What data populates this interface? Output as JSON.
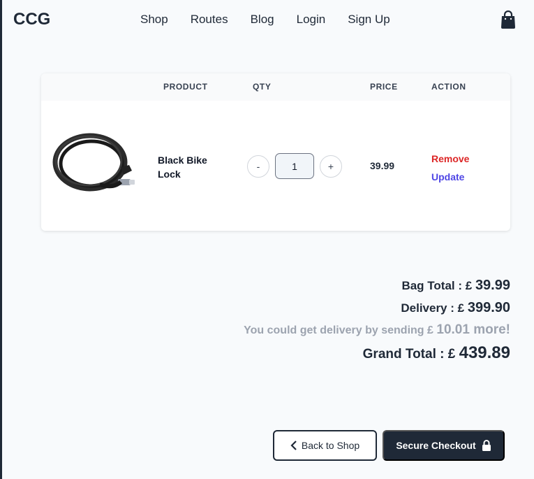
{
  "header": {
    "logo": "CCG",
    "nav": [
      "Shop",
      "Routes",
      "Blog",
      "Login",
      "Sign Up"
    ]
  },
  "cart": {
    "columns": {
      "product": "PRODUCT",
      "qty": "QTY",
      "price": "PRICE",
      "action": "ACTION"
    },
    "items": [
      {
        "name": "Black Bike Lock",
        "quantity": "1",
        "price": "39.99",
        "decrement_label": "-",
        "increment_label": "+",
        "remove_label": "Remove",
        "update_label": "Update"
      }
    ]
  },
  "totals": {
    "bag_label": "Bag Total : £",
    "bag_value": "39.99",
    "delivery_label": "Delivery : £",
    "delivery_value": "399.90",
    "hint_label": "You could get delivery by sending £",
    "hint_value": "10.01 more!",
    "grand_label": "Grand Total : £",
    "grand_value": "439.89"
  },
  "actions": {
    "back_label": "Back to Shop",
    "checkout_label": "Secure Checkout"
  },
  "colors": {
    "accent_dark": "#1f2937",
    "remove": "#dc2626",
    "update": "#4f46e5",
    "hint": "#9ca3af"
  }
}
